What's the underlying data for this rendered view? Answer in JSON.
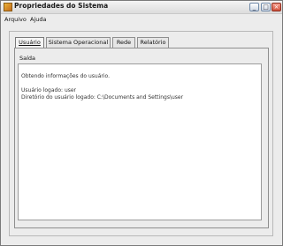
{
  "window": {
    "title": "Propriedades do Sistema",
    "minimize_glyph": "_",
    "maximize_glyph": "□",
    "close_glyph": "×"
  },
  "menu": {
    "items": [
      {
        "label": "Arquivo"
      },
      {
        "label": "Ajuda"
      }
    ]
  },
  "tabs": [
    {
      "label": "Usuário",
      "active": true
    },
    {
      "label": "Sistema Operacional",
      "active": false
    },
    {
      "label": "Rede",
      "active": false
    },
    {
      "label": "Relatório",
      "active": false
    }
  ],
  "panel": {
    "section_label": "Saída",
    "output_lines": [
      "Obtendo informações do usuário.",
      "",
      "Usuário logado: user",
      "Diretório do usuário logado: C:\\Documents and Settings\\user"
    ]
  },
  "colors": {
    "window_bg": "#ececec",
    "close_button": "#d2523c"
  }
}
